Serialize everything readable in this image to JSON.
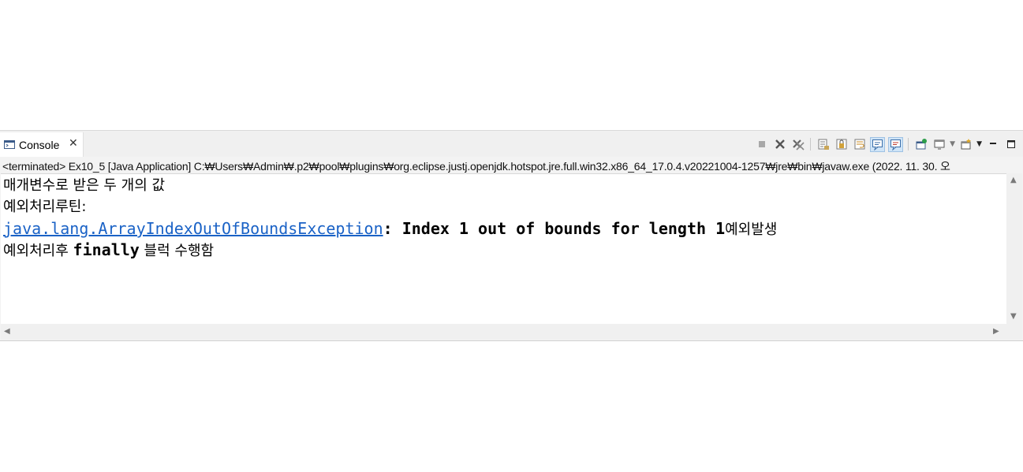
{
  "tab": {
    "label": "Console",
    "close": "✕"
  },
  "status": "<terminated> Ex10_5 [Java Application] C:₩Users₩Admin₩.p2₩pool₩plugins₩org.eclipse.justj.openjdk.hotspot.jre.full.win32.x86_64_17.0.4.v20221004-1257₩jre₩bin₩javaw.exe  (2022. 11. 30. 오",
  "console": {
    "line1": "매개변수로 받은 두 개의 값",
    "line2": "예외처리루틴:",
    "line3_link": "java.lang.ArrayIndexOutOfBoundsException",
    "line3_rest": ": Index 1 out of bounds for length 1",
    "line3_ko": "예외발생",
    "line4_a": "예외처리후 ",
    "line4_b": "finally",
    "line4_c": " 블럭 수행함"
  },
  "toolbar": {
    "icons": [
      "terminate-icon",
      "remove-launch-icon",
      "remove-all-terminated-icon",
      "clear-console-icon",
      "scroll-lock-icon",
      "word-wrap-icon",
      "show-on-stdout-icon",
      "show-on-stderr-icon",
      "pin-console-icon",
      "display-selected-console-icon",
      "open-console-icon",
      "minimize-icon",
      "maximize-icon"
    ]
  },
  "colors": {
    "link": "#1a62c6",
    "pressed": "#cfe4f7"
  }
}
